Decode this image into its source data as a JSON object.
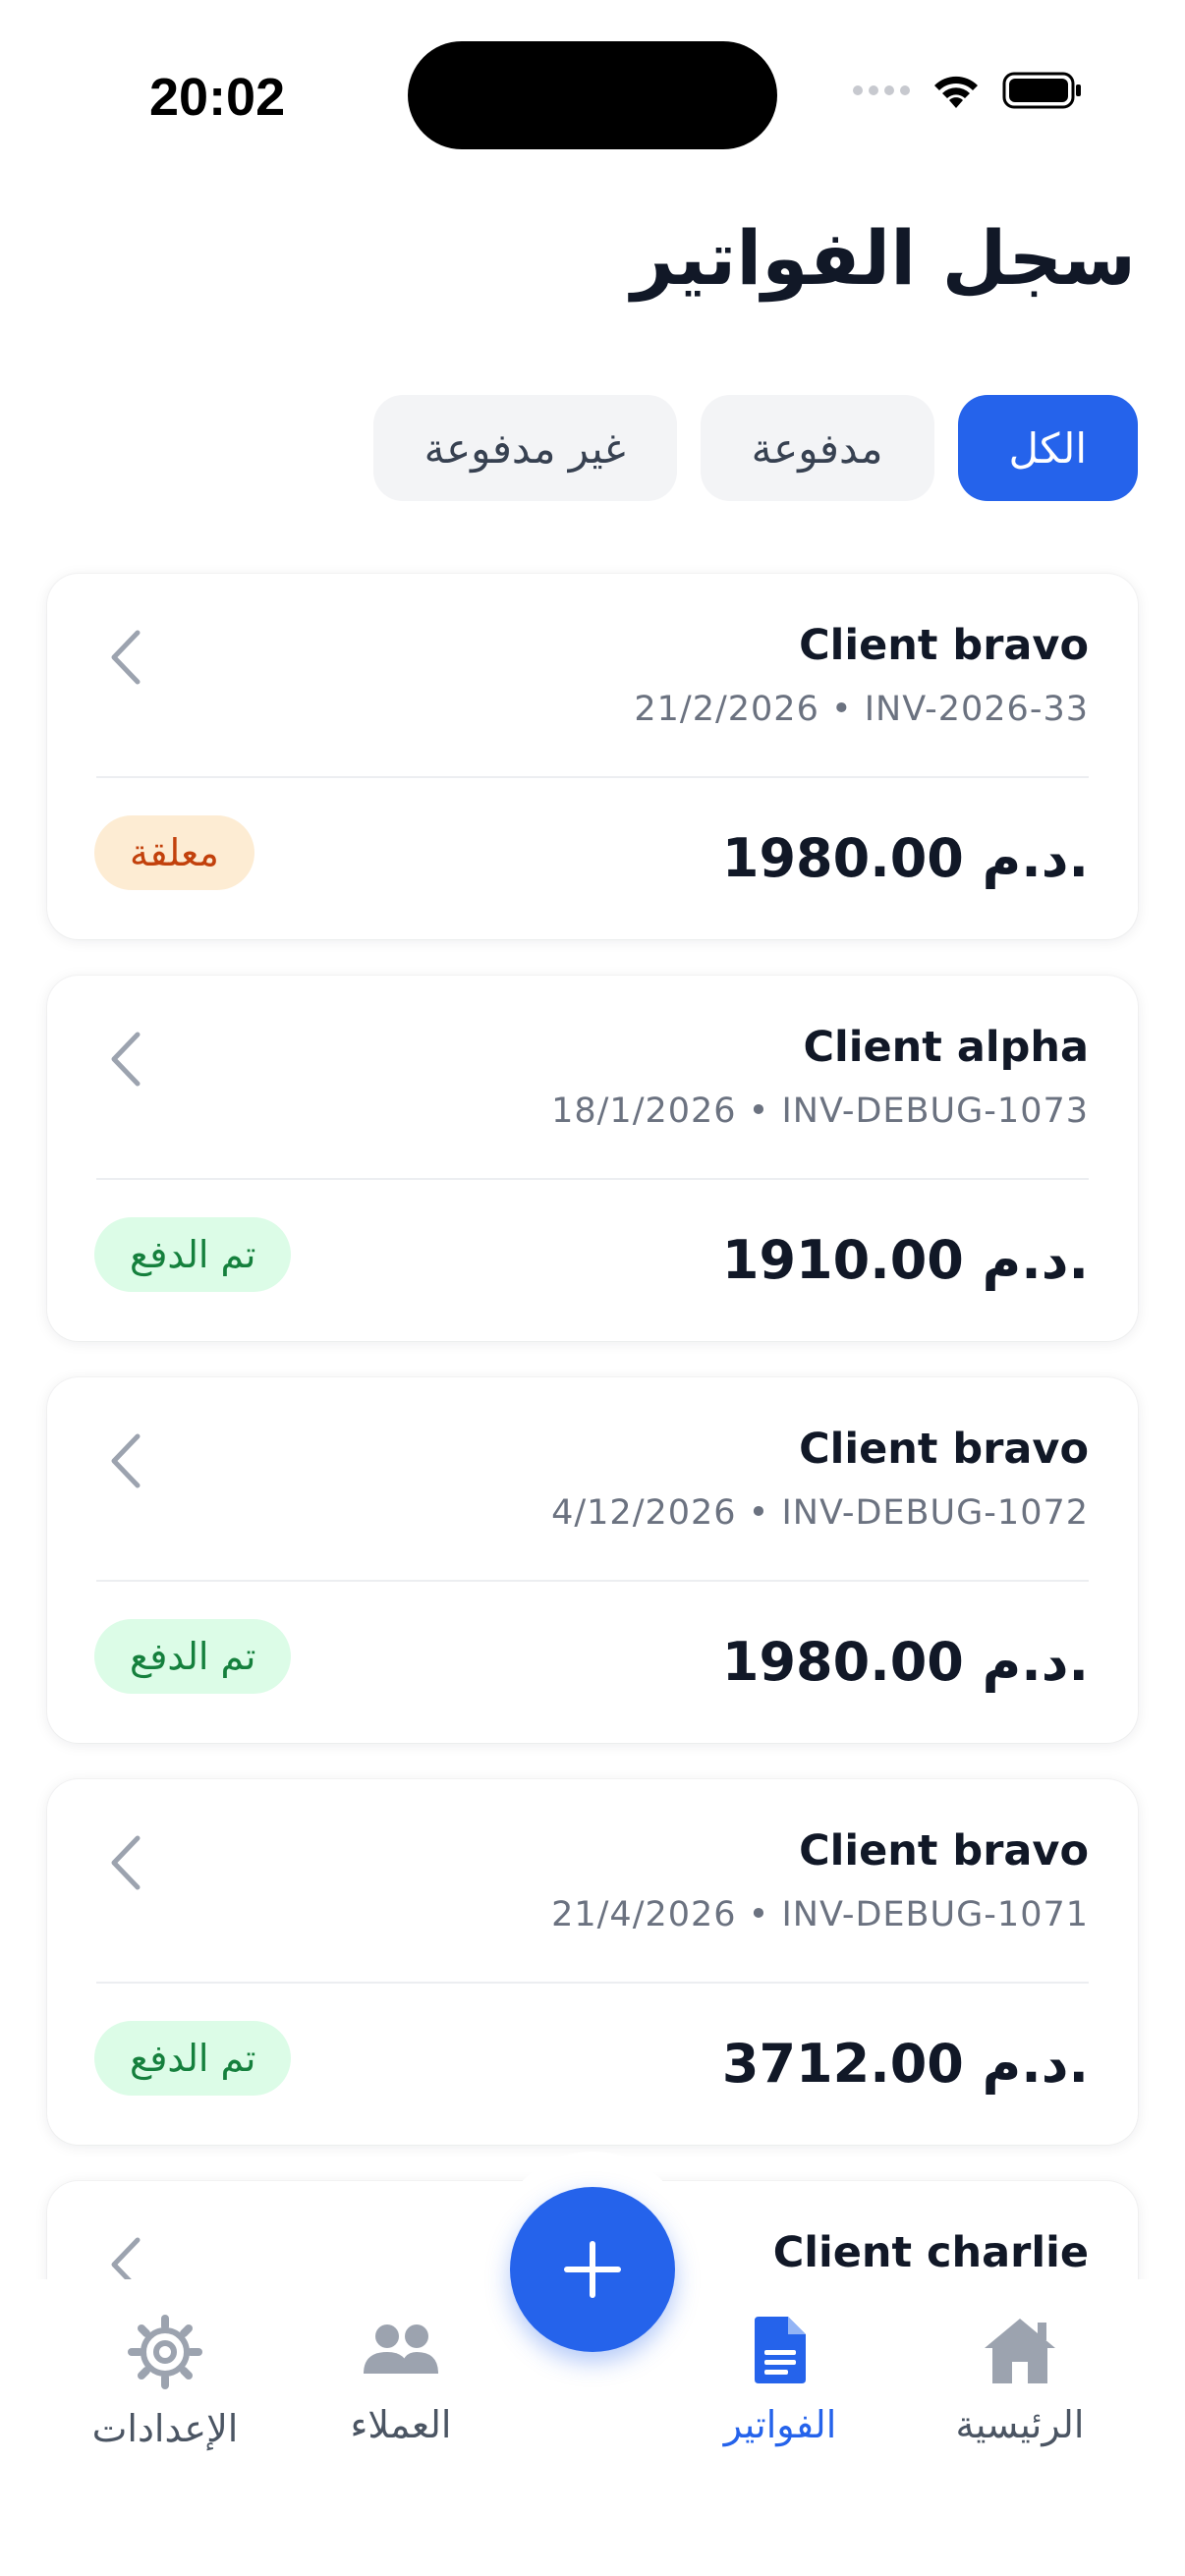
{
  "status_bar": {
    "time": "20:02"
  },
  "header": {
    "title": "سجل الفواتير"
  },
  "filters": [
    {
      "label": "الكل",
      "active": true
    },
    {
      "label": "مدفوعة",
      "active": false
    },
    {
      "label": "غير مدفوعة",
      "active": false
    }
  ],
  "invoices": [
    {
      "client": "Client bravo",
      "meta": "21/2/2026 • INV-2026-33",
      "amount": "1980.00 د.م.",
      "status": "معلقة",
      "status_type": "pending"
    },
    {
      "client": "Client alpha",
      "meta": "18/1/2026 • INV-DEBUG-1073",
      "amount": "1910.00 د.م.",
      "status": "تم الدفع",
      "status_type": "paid"
    },
    {
      "client": "Client bravo",
      "meta": "4/12/2026 • INV-DEBUG-1072",
      "amount": "1980.00 د.م.",
      "status": "تم الدفع",
      "status_type": "paid"
    },
    {
      "client": "Client bravo",
      "meta": "21/4/2026 • INV-DEBUG-1071",
      "amount": "3712.00 د.م.",
      "status": "تم الدفع",
      "status_type": "paid"
    },
    {
      "client": "Client charlie"
    }
  ],
  "bottom_nav": {
    "home": "الرئيسية",
    "invoices": "الفواتير",
    "clients": "العملاء",
    "settings": "الإعدادات",
    "active": "invoices"
  },
  "colors": {
    "accent": "#2563eb",
    "pending_bg": "#fdecd3",
    "pending_text": "#c2410c",
    "paid_bg": "#dcfce7",
    "paid_text": "#15803d"
  },
  "icons": {
    "fab": "plus-icon",
    "home": "home-icon",
    "invoices": "document-icon",
    "clients": "users-icon",
    "settings": "gear-icon"
  }
}
